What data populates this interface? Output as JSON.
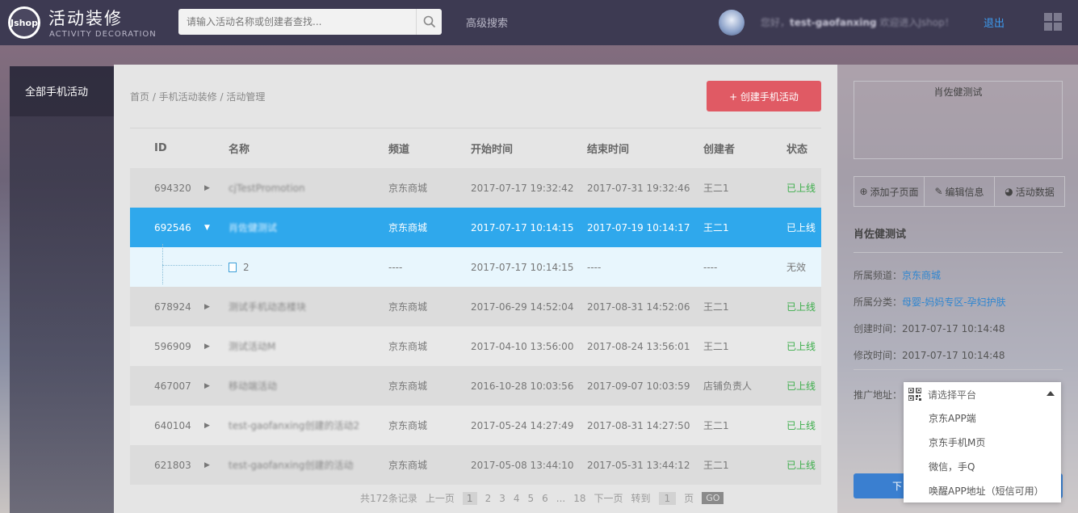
{
  "header": {
    "logo_text": "Jshop",
    "brand_cn": "活动装修",
    "brand_en": "ACTIVITY DECORATION",
    "search_placeholder": "请输入活动名称或创建者查找...",
    "advanced_search": "高级搜索",
    "welcome_prefix": "您好，",
    "username": "test-gaofanxing",
    "welcome_suffix": " 欢迎进入Jshop！",
    "logout": "退出"
  },
  "sidebar": {
    "items": [
      {
        "label": "全部手机活动"
      }
    ]
  },
  "main": {
    "breadcrumb": "首页 / 手机活动装修 / 活动管理",
    "create_button": "+ 创建手机活动",
    "columns": [
      "ID",
      "名称",
      "频道",
      "开始时间",
      "结束时间",
      "创建者",
      "状态"
    ],
    "rows": [
      {
        "id": "694320",
        "name": "cjTestPromotion",
        "channel": "京东商城",
        "start": "2017-07-17 19:32:42",
        "end": "2017-07-31 19:32:46",
        "creator": "王二1",
        "status": "已上线"
      },
      {
        "id": "692546",
        "name": "肖佐健测试",
        "channel": "京东商城",
        "start": "2017-07-17 10:14:15",
        "end": "2017-07-19 10:14:17",
        "creator": "王二1",
        "status": "已上线"
      },
      {
        "id": "678924",
        "name": "测试手机动态楼块",
        "channel": "京东商城",
        "start": "2017-06-29 14:52:04",
        "end": "2017-08-31 14:52:06",
        "creator": "王二1",
        "status": "已上线"
      },
      {
        "id": "596909",
        "name": "测试活动M",
        "channel": "京东商城",
        "start": "2017-04-10 13:56:00",
        "end": "2017-08-24 13:56:01",
        "creator": "王二1",
        "status": "已上线"
      },
      {
        "id": "467007",
        "name": "移动端活动",
        "channel": "京东商城",
        "start": "2016-10-28 10:03:56",
        "end": "2017-09-07 10:03:59",
        "creator": "店铺负责人",
        "status": "已上线"
      },
      {
        "id": "640104",
        "name": "test-gaofanxing创建的活动2",
        "channel": "京东商城",
        "start": "2017-05-24 14:27:49",
        "end": "2017-08-31 14:27:50",
        "creator": "王二1",
        "status": "已上线"
      },
      {
        "id": "621803",
        "name": "test-gaofanxing创建的活动",
        "channel": "京东商城",
        "start": "2017-05-08 13:44:10",
        "end": "2017-05-31 13:44:12",
        "creator": "王二1",
        "status": "已上线"
      }
    ],
    "child_row": {
      "name": "2",
      "channel": "----",
      "start": "2017-07-17 10:14:15",
      "end": "----",
      "creator": "----",
      "status": "无效"
    },
    "pager": {
      "total": "共172条记录",
      "prev": "上一页",
      "pages": [
        "1",
        "2",
        "3",
        "4",
        "5",
        "6",
        "...",
        "18"
      ],
      "next": "下一页",
      "goto": "转到",
      "goto_value": "1",
      "page_unit": "页",
      "go": "GO"
    }
  },
  "detail": {
    "preview_title": "肖佐健测试",
    "actions": [
      {
        "label": "添加子页面"
      },
      {
        "label": "编辑信息"
      },
      {
        "label": "活动数据"
      }
    ],
    "title": "肖佐健测试",
    "channel_label": "所属频道：",
    "channel_value": "京东商城",
    "category_label": "所属分类：",
    "category_value": "母婴-妈妈专区-孕妇护肤",
    "created_label": "创建时间：",
    "created_value": "2017-07-17 10:14:48",
    "modified_label": "修改时间：",
    "modified_value": "2017-07-17 10:14:48",
    "promo_label": "推广地址：",
    "bottom_button": "下"
  },
  "dropdown": {
    "placeholder": "请选择平台",
    "options": [
      "京东APP端",
      "京东手机M页",
      "微信，手Q",
      "唤醒APP地址（短信可用）"
    ]
  }
}
